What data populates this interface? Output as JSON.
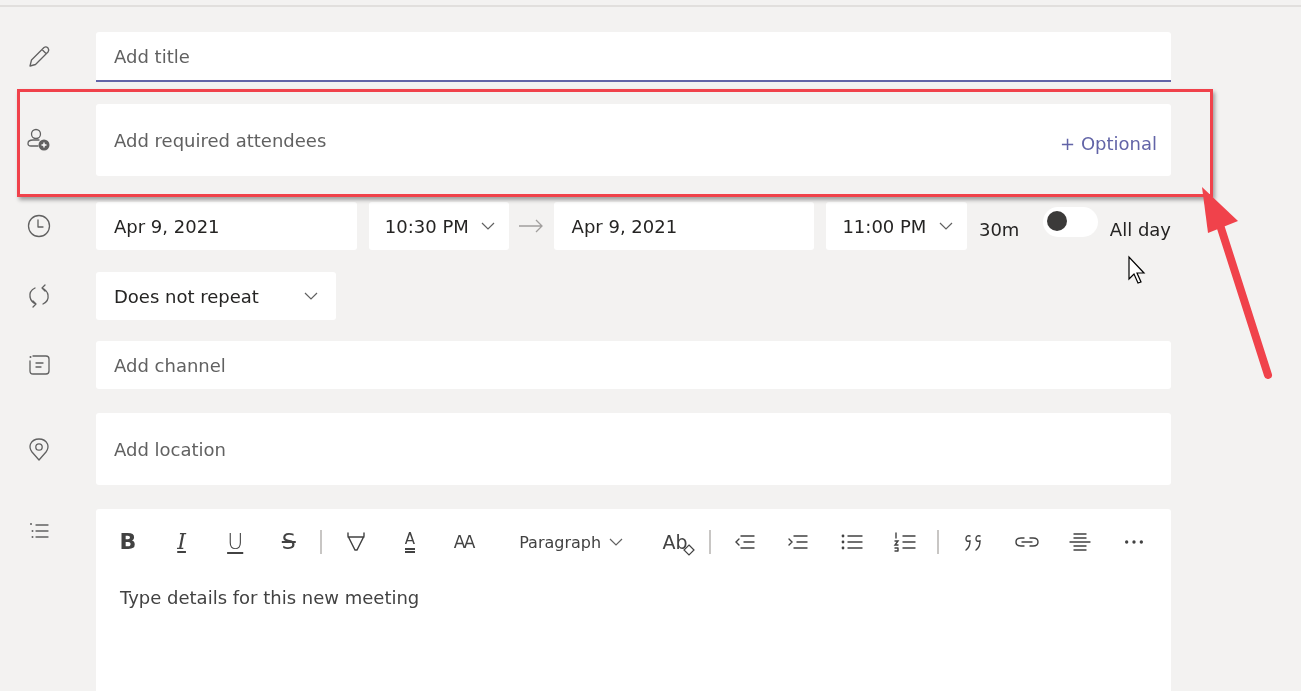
{
  "title_field": {
    "placeholder": "Add title",
    "focused": true
  },
  "attendees": {
    "placeholder": "Add required attendees",
    "optional_link": "+ Optional",
    "highlighted": true
  },
  "schedule": {
    "start_date": "Apr 9, 2021",
    "start_time": "10:30 PM",
    "end_date": "Apr 9, 2021",
    "end_time": "11:00 PM",
    "duration": "30m",
    "all_day": {
      "label": "All day",
      "on": false
    }
  },
  "repeat": {
    "value": "Does not repeat"
  },
  "channel": {
    "placeholder": "Add channel"
  },
  "location": {
    "placeholder": "Add location"
  },
  "editor": {
    "toolbar": [
      {
        "kind": "bold",
        "label": "B"
      },
      {
        "kind": "italic",
        "label": "I"
      },
      {
        "kind": "underline",
        "label": "U"
      },
      {
        "kind": "strike",
        "label": "S"
      },
      {
        "kind": "divider"
      },
      {
        "kind": "highlight"
      },
      {
        "kind": "font-color",
        "label": "A"
      },
      {
        "kind": "font-size",
        "label": "AA"
      },
      {
        "kind": "paragraph",
        "label": "Paragraph"
      },
      {
        "kind": "clear-format",
        "label": "Ab"
      },
      {
        "kind": "divider"
      },
      {
        "kind": "outdent"
      },
      {
        "kind": "indent"
      },
      {
        "kind": "bullets"
      },
      {
        "kind": "numbering"
      },
      {
        "kind": "divider"
      },
      {
        "kind": "quote"
      },
      {
        "kind": "link"
      },
      {
        "kind": "rule"
      },
      {
        "kind": "more"
      }
    ],
    "placeholder": "Type details for this new meeting"
  }
}
